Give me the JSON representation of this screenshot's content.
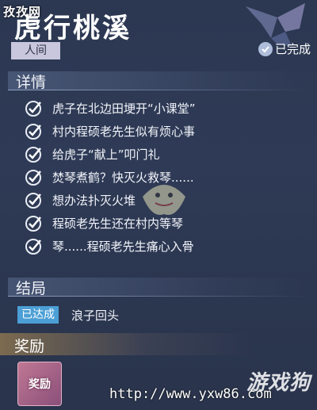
{
  "watermark_top": "孜孜网",
  "quest": {
    "title": "虎行桃溪",
    "realm": "人间",
    "status": "已完成"
  },
  "details": {
    "header": "详情",
    "tasks": [
      "虎子在北边田埂开“小课堂”",
      "村内程硕老先生似有烦心事",
      "给虎子“献上”叩门礼",
      "焚琴煮鹤？快灭火救琴......",
      "想办法扑灭火堆",
      "程硕老先生还在村内等琴",
      "琴......程硕老先生痛心入骨"
    ]
  },
  "ending": {
    "header": "结局",
    "tag": "已达成",
    "value": "浪子回头"
  },
  "reward": {
    "header": "奖励",
    "item_label": "奖励"
  },
  "watermark_bottom": {
    "url": "http://www.yxw86.com",
    "logo": "游戏狗"
  },
  "colors": {
    "background": "#2d3953",
    "accent_blue": "#4c9fd6",
    "reward_gold": "#be9650"
  }
}
